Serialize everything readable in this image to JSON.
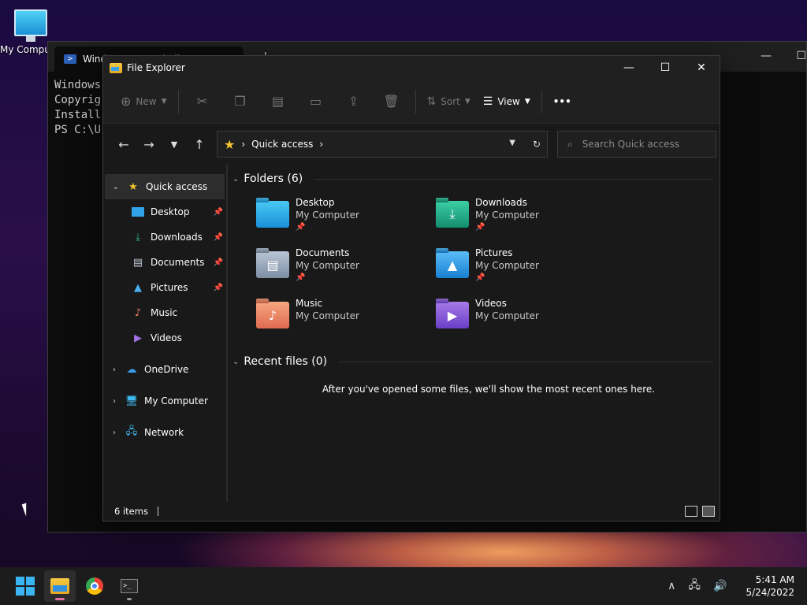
{
  "desktop": {
    "icon_label": "My Computer"
  },
  "powershell": {
    "tab_title": "Windows PowerShell",
    "lines": [
      "Windows",
      "Copyrig",
      "",
      "Install",
      "",
      "PS C:\\U"
    ]
  },
  "explorer": {
    "title": "File Explorer",
    "toolbar": {
      "new_label": "New",
      "sort_label": "Sort",
      "view_label": "View",
      "more_label": "•••"
    },
    "address": {
      "location": "Quick access"
    },
    "search": {
      "placeholder": "Search Quick access"
    },
    "sidebar": {
      "quick_access": "Quick access",
      "pinned": [
        {
          "label": "Desktop"
        },
        {
          "label": "Downloads"
        },
        {
          "label": "Documents"
        },
        {
          "label": "Pictures"
        },
        {
          "label": "Music"
        },
        {
          "label": "Videos"
        }
      ],
      "onedrive": "OneDrive",
      "my_computer": "My Computer",
      "network": "Network"
    },
    "folders_header": "Folders (6)",
    "folders": [
      {
        "name": "Desktop",
        "location": "My Computer"
      },
      {
        "name": "Downloads",
        "location": "My Computer"
      },
      {
        "name": "Documents",
        "location": "My Computer"
      },
      {
        "name": "Pictures",
        "location": "My Computer"
      },
      {
        "name": "Music",
        "location": "My Computer"
      },
      {
        "name": "Videos",
        "location": "My Computer"
      }
    ],
    "recent_header": "Recent files (0)",
    "recent_empty": "After you've opened some files, we'll show the most recent ones here.",
    "status": "6 items"
  },
  "taskbar": {
    "time": "5:41 AM",
    "date": "5/24/2022"
  },
  "colors": {
    "accent": "#3ab4f2",
    "window_bg": "#191919",
    "star": "#f4c430"
  }
}
